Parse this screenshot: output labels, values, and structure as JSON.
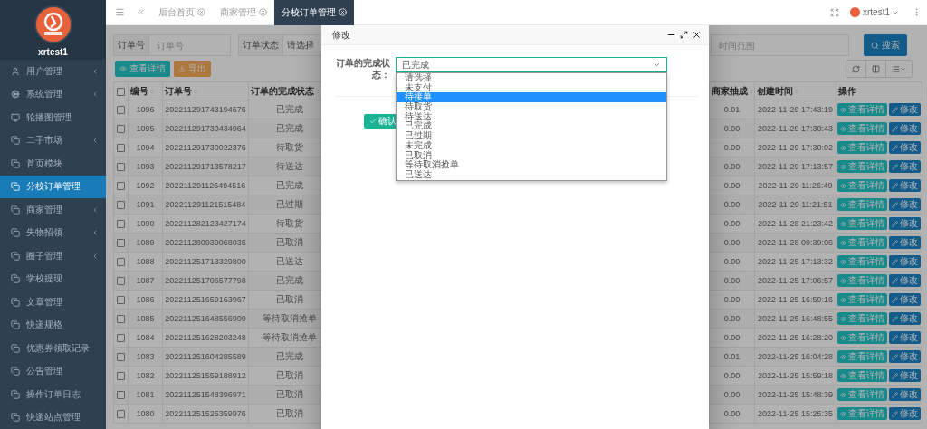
{
  "sidebar": {
    "user": "xrtest1",
    "items": [
      {
        "label": "用户管理",
        "collapsible": true,
        "selected": false
      },
      {
        "label": "系统管理",
        "collapsible": true,
        "selected": false
      },
      {
        "label": "轮播图管理",
        "collapsible": false,
        "selected": false
      },
      {
        "label": "二手市场",
        "collapsible": true,
        "selected": false
      },
      {
        "label": "首页模块",
        "collapsible": false,
        "selected": false
      },
      {
        "label": "分校订单管理",
        "collapsible": false,
        "selected": true
      },
      {
        "label": "商家管理",
        "collapsible": true,
        "selected": false
      },
      {
        "label": "失物招领",
        "collapsible": true,
        "selected": false
      },
      {
        "label": "圈子管理",
        "collapsible": true,
        "selected": false
      },
      {
        "label": "学校提现",
        "collapsible": false,
        "selected": false
      },
      {
        "label": "文章管理",
        "collapsible": false,
        "selected": false
      },
      {
        "label": "快递规格",
        "collapsible": false,
        "selected": false
      },
      {
        "label": "优惠券领取记录",
        "collapsible": false,
        "selected": false
      },
      {
        "label": "公告管理",
        "collapsible": false,
        "selected": false
      },
      {
        "label": "操作订单日志",
        "collapsible": false,
        "selected": false
      },
      {
        "label": "快递站点管理",
        "collapsible": false,
        "selected": false
      }
    ]
  },
  "topbar": {
    "tabs": [
      {
        "label": "后台首页",
        "selected": false
      },
      {
        "label": "商家管理",
        "selected": false
      },
      {
        "label": "分校订单管理",
        "selected": true
      }
    ],
    "user": "xrtest1"
  },
  "search": {
    "fields": [
      {
        "kind": "input",
        "label": "订单号",
        "placeholder": "订单号"
      },
      {
        "kind": "select",
        "label": "订单状态",
        "value": "请选择"
      }
    ],
    "time": {
      "placeholder": "时间范围"
    },
    "button": "搜索"
  },
  "toolbar": {
    "buttons": [
      {
        "kind": "info",
        "label": "查看详情"
      },
      {
        "kind": "warning",
        "label": "导出"
      }
    ]
  },
  "table": {
    "all_checked": false,
    "columns": [
      {
        "label": "编号",
        "sortable": true
      },
      {
        "label": "订单号",
        "sortable": true
      },
      {
        "label": "订单的完成状态",
        "sortable": true
      },
      {
        "label": "商家抽成",
        "sortable": true
      },
      {
        "label": "创建时间",
        "sortable": true
      },
      {
        "label": "操作",
        "sortable": false
      }
    ],
    "rows": [
      {
        "checked": false,
        "cells": [
          "1096",
          "202211291743194676",
          "已完成",
          "0.01",
          "2022-11-29 17:43:19"
        ],
        "actions": [
          "查看详情",
          "修改"
        ]
      },
      {
        "checked": false,
        "cells": [
          "1095",
          "202211291730434964",
          "已完成",
          "0.00",
          "2022-11-29 17:30:43"
        ],
        "actions": [
          "查看详情",
          "修改"
        ]
      },
      {
        "checked": false,
        "cells": [
          "1094",
          "202211291730022376",
          "待取货",
          "0.00",
          "2022-11-29 17:30:02"
        ],
        "actions": [
          "查看详情",
          "修改"
        ]
      },
      {
        "checked": false,
        "cells": [
          "1093",
          "202211291713578217",
          "待送达",
          "0.00",
          "2022-11-29 17:13:57"
        ],
        "actions": [
          "查看详情",
          "修改"
        ]
      },
      {
        "checked": false,
        "cells": [
          "1092",
          "202211291126494516",
          "已完成",
          "0.00",
          "2022-11-29 11:26:49"
        ],
        "actions": [
          "查看详情",
          "修改"
        ]
      },
      {
        "checked": false,
        "cells": [
          "1091",
          "202211291121515484",
          "已过期",
          "0.00",
          "2022-11-29 11:21:51"
        ],
        "actions": [
          "查看详情",
          "修改"
        ]
      },
      {
        "checked": false,
        "cells": [
          "1090",
          "202211282123427174",
          "待取货",
          "0.00",
          "2022-11-28 21:23:42"
        ],
        "actions": [
          "查看详情",
          "修改"
        ]
      },
      {
        "checked": false,
        "cells": [
          "1089",
          "202211280939068036",
          "已取消",
          "0.00",
          "2022-11-28 09:39:06"
        ],
        "actions": [
          "查看详情",
          "修改"
        ]
      },
      {
        "checked": false,
        "cells": [
          "1088",
          "202211251713329800",
          "已送达",
          "0.00",
          "2022-11-25 17:13:32"
        ],
        "actions": [
          "查看详情",
          "修改"
        ]
      },
      {
        "checked": false,
        "cells": [
          "1087",
          "202211251706577798",
          "已完成",
          "0.00",
          "2022-11-25 17:06:57"
        ],
        "actions": [
          "查看详情",
          "修改"
        ]
      },
      {
        "checked": false,
        "cells": [
          "1086",
          "202211251659163967",
          "已取消",
          "0.00",
          "2022-11-25 16:59:16"
        ],
        "actions": [
          "查看详情",
          "修改"
        ]
      },
      {
        "checked": false,
        "cells": [
          "1085",
          "202211251648556909",
          "等待取消抢单",
          "0.00",
          "2022-11-25 16:48:55"
        ],
        "actions": [
          "查看详情",
          "修改"
        ]
      },
      {
        "checked": false,
        "cells": [
          "1084",
          "202211251628203248",
          "等待取消抢单",
          "0.00",
          "2022-11-25 16:28:20"
        ],
        "actions": [
          "查看详情",
          "修改"
        ]
      },
      {
        "checked": false,
        "cells": [
          "1083",
          "202211251604285589",
          "已完成",
          "0.01",
          "2022-11-25 16:04:28"
        ],
        "actions": [
          "查看详情",
          "修改"
        ]
      },
      {
        "checked": false,
        "cells": [
          "1082",
          "202211251559188912",
          "已取消",
          "0.00",
          "2022-11-25 15:59:18"
        ],
        "actions": [
          "查看详情",
          "修改"
        ]
      },
      {
        "checked": false,
        "cells": [
          "1081",
          "202211251548396971",
          "已取消",
          "0.00",
          "2022-11-25 15:48:39"
        ],
        "actions": [
          "查看详情",
          "修改"
        ]
      },
      {
        "checked": false,
        "cells": [
          "1080",
          "202211251525359976",
          "已取消",
          "0.00",
          "2022-11-25 15:25:35"
        ],
        "actions": [
          "查看详情",
          "修改"
        ]
      }
    ]
  },
  "modal": {
    "title": "修改",
    "field": {
      "label": "订单的完成状态：",
      "value": "已完成",
      "options": [
        {
          "label": "请选择",
          "highlighted": false
        },
        {
          "label": "未支付",
          "highlighted": false
        },
        {
          "label": "待接单",
          "highlighted": true
        },
        {
          "label": "待取货",
          "highlighted": false
        },
        {
          "label": "待送达",
          "highlighted": false
        },
        {
          "label": "已完成",
          "highlighted": false
        },
        {
          "label": "已过期",
          "highlighted": false
        },
        {
          "label": "未完成",
          "highlighted": false
        },
        {
          "label": "已取消",
          "highlighted": false
        },
        {
          "label": "等待取消抢单",
          "highlighted": false
        },
        {
          "label": "已送达",
          "highlighted": false
        }
      ]
    },
    "submit": "确认"
  }
}
